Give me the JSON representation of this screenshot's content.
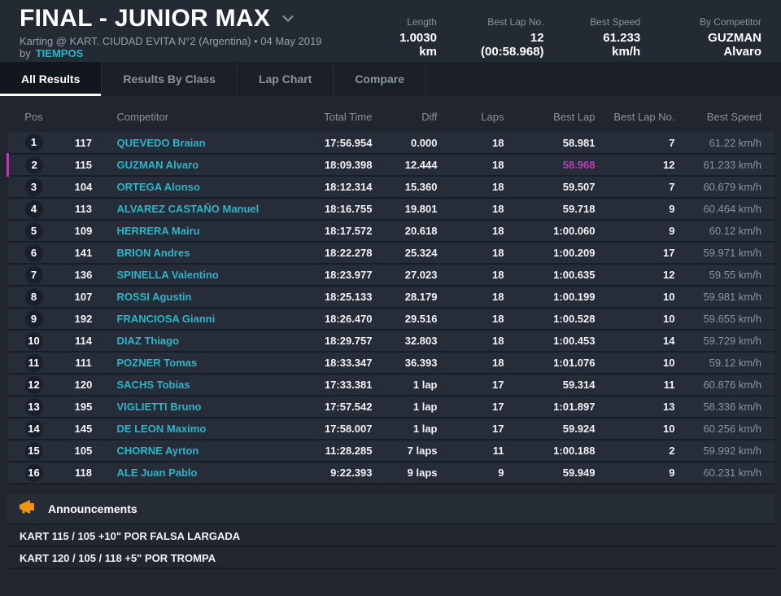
{
  "colors": {
    "accent_cyan": "#2bb6c9",
    "overall_best_magenta": "#b93eb9",
    "highlight_border_magenta": "#cb2fc0",
    "announcement_orange": "#f0930f",
    "header_bg": "#242a34",
    "row_bg": "#272d38"
  },
  "header": {
    "title": "FINAL - JUNIOR MAX",
    "subtitle_prefix": "Karting @ KART. CIUDAD EVITA N°2 (Argentina) • 04 May 2019 by",
    "subtitle_link": "TIEMPOS",
    "stats": [
      {
        "label": "Length",
        "value": "1.0030 km"
      },
      {
        "label": "Best Lap No.",
        "value": "12 (00:58.968)"
      },
      {
        "label": "Best Speed",
        "value": "61.233 km/h"
      },
      {
        "label": "By Competitor",
        "value": "GUZMAN Alvaro"
      }
    ]
  },
  "tabs": [
    {
      "label": "All Results",
      "active": true
    },
    {
      "label": "Results By Class",
      "active": false
    },
    {
      "label": "Lap Chart",
      "active": false
    },
    {
      "label": "Compare",
      "active": false
    }
  ],
  "table": {
    "columns": {
      "pos": "Pos",
      "kart": "",
      "competitor": "Competitor",
      "total_time": "Total Time",
      "diff": "Diff",
      "laps": "Laps",
      "best_lap": "Best Lap",
      "best_lap_no": "Best Lap No.",
      "best_speed": "Best Speed"
    },
    "rows": [
      {
        "pos": "1",
        "kart": "117",
        "competitor": "QUEVEDO Braian",
        "total_time": "17:56.954",
        "diff": "0.000",
        "laps": "18",
        "best_lap": "58.981",
        "best_lap_no": "7",
        "best_speed": "61.22 km/h",
        "highlight": false,
        "best_lap_overall": false
      },
      {
        "pos": "2",
        "kart": "115",
        "competitor": "GUZMAN Alvaro",
        "total_time": "18:09.398",
        "diff": "12.444",
        "laps": "18",
        "best_lap": "58.968",
        "best_lap_no": "12",
        "best_speed": "61.233 km/h",
        "highlight": true,
        "best_lap_overall": true
      },
      {
        "pos": "3",
        "kart": "104",
        "competitor": "ORTEGA Alonso",
        "total_time": "18:12.314",
        "diff": "15.360",
        "laps": "18",
        "best_lap": "59.507",
        "best_lap_no": "7",
        "best_speed": "60.679 km/h",
        "highlight": false,
        "best_lap_overall": false
      },
      {
        "pos": "4",
        "kart": "113",
        "competitor": "ALVAREZ CASTAÑO Manuel",
        "total_time": "18:16.755",
        "diff": "19.801",
        "laps": "18",
        "best_lap": "59.718",
        "best_lap_no": "9",
        "best_speed": "60.464 km/h",
        "highlight": false,
        "best_lap_overall": false
      },
      {
        "pos": "5",
        "kart": "109",
        "competitor": "HERRERA Mairu",
        "total_time": "18:17.572",
        "diff": "20.618",
        "laps": "18",
        "best_lap": "1:00.060",
        "best_lap_no": "9",
        "best_speed": "60.12 km/h",
        "highlight": false,
        "best_lap_overall": false
      },
      {
        "pos": "6",
        "kart": "141",
        "competitor": "BRION Andres",
        "total_time": "18:22.278",
        "diff": "25.324",
        "laps": "18",
        "best_lap": "1:00.209",
        "best_lap_no": "17",
        "best_speed": "59.971 km/h",
        "highlight": false,
        "best_lap_overall": false
      },
      {
        "pos": "7",
        "kart": "136",
        "competitor": "SPINELLA Valentino",
        "total_time": "18:23.977",
        "diff": "27.023",
        "laps": "18",
        "best_lap": "1:00.635",
        "best_lap_no": "12",
        "best_speed": "59.55 km/h",
        "highlight": false,
        "best_lap_overall": false
      },
      {
        "pos": "8",
        "kart": "107",
        "competitor": "ROSSI Agustin",
        "total_time": "18:25.133",
        "diff": "28.179",
        "laps": "18",
        "best_lap": "1:00.199",
        "best_lap_no": "10",
        "best_speed": "59.981 km/h",
        "highlight": false,
        "best_lap_overall": false
      },
      {
        "pos": "9",
        "kart": "192",
        "competitor": "FRANCIOSA Gianni",
        "total_time": "18:26.470",
        "diff": "29.516",
        "laps": "18",
        "best_lap": "1:00.528",
        "best_lap_no": "10",
        "best_speed": "59.655 km/h",
        "highlight": false,
        "best_lap_overall": false
      },
      {
        "pos": "10",
        "kart": "114",
        "competitor": "DIAZ Thiago",
        "total_time": "18:29.757",
        "diff": "32.803",
        "laps": "18",
        "best_lap": "1:00.453",
        "best_lap_no": "14",
        "best_speed": "59.729 km/h",
        "highlight": false,
        "best_lap_overall": false
      },
      {
        "pos": "11",
        "kart": "111",
        "competitor": "POZNER Tomas",
        "total_time": "18:33.347",
        "diff": "36.393",
        "laps": "18",
        "best_lap": "1:01.076",
        "best_lap_no": "10",
        "best_speed": "59.12 km/h",
        "highlight": false,
        "best_lap_overall": false
      },
      {
        "pos": "12",
        "kart": "120",
        "competitor": "SACHS Tobias",
        "total_time": "17:33.381",
        "diff": "1 lap",
        "laps": "17",
        "best_lap": "59.314",
        "best_lap_no": "11",
        "best_speed": "60.876 km/h",
        "highlight": false,
        "best_lap_overall": false
      },
      {
        "pos": "13",
        "kart": "195",
        "competitor": "VIGLIETTI Bruno",
        "total_time": "17:57.542",
        "diff": "1 lap",
        "laps": "17",
        "best_lap": "1:01.897",
        "best_lap_no": "13",
        "best_speed": "58.336 km/h",
        "highlight": false,
        "best_lap_overall": false
      },
      {
        "pos": "14",
        "kart": "145",
        "competitor": "DE LEON Maximo",
        "total_time": "17:58.007",
        "diff": "1 lap",
        "laps": "17",
        "best_lap": "59.924",
        "best_lap_no": "10",
        "best_speed": "60.256 km/h",
        "highlight": false,
        "best_lap_overall": false
      },
      {
        "pos": "15",
        "kart": "105",
        "competitor": "CHORNE Ayrton",
        "total_time": "11:28.285",
        "diff": "7 laps",
        "laps": "11",
        "best_lap": "1:00.188",
        "best_lap_no": "2",
        "best_speed": "59.992 km/h",
        "highlight": false,
        "best_lap_overall": false
      },
      {
        "pos": "16",
        "kart": "118",
        "competitor": "ALE Juan Pablo",
        "total_time": "9:22.393",
        "diff": "9 laps",
        "laps": "9",
        "best_lap": "59.949",
        "best_lap_no": "9",
        "best_speed": "60.231 km/h",
        "highlight": false,
        "best_lap_overall": false
      }
    ]
  },
  "announcements": {
    "title": "Announcements",
    "items": [
      "KART 115 / 105 +10\" POR FALSA LARGADA",
      "KART 120 / 105 / 118 +5\" POR TROMPA"
    ]
  }
}
